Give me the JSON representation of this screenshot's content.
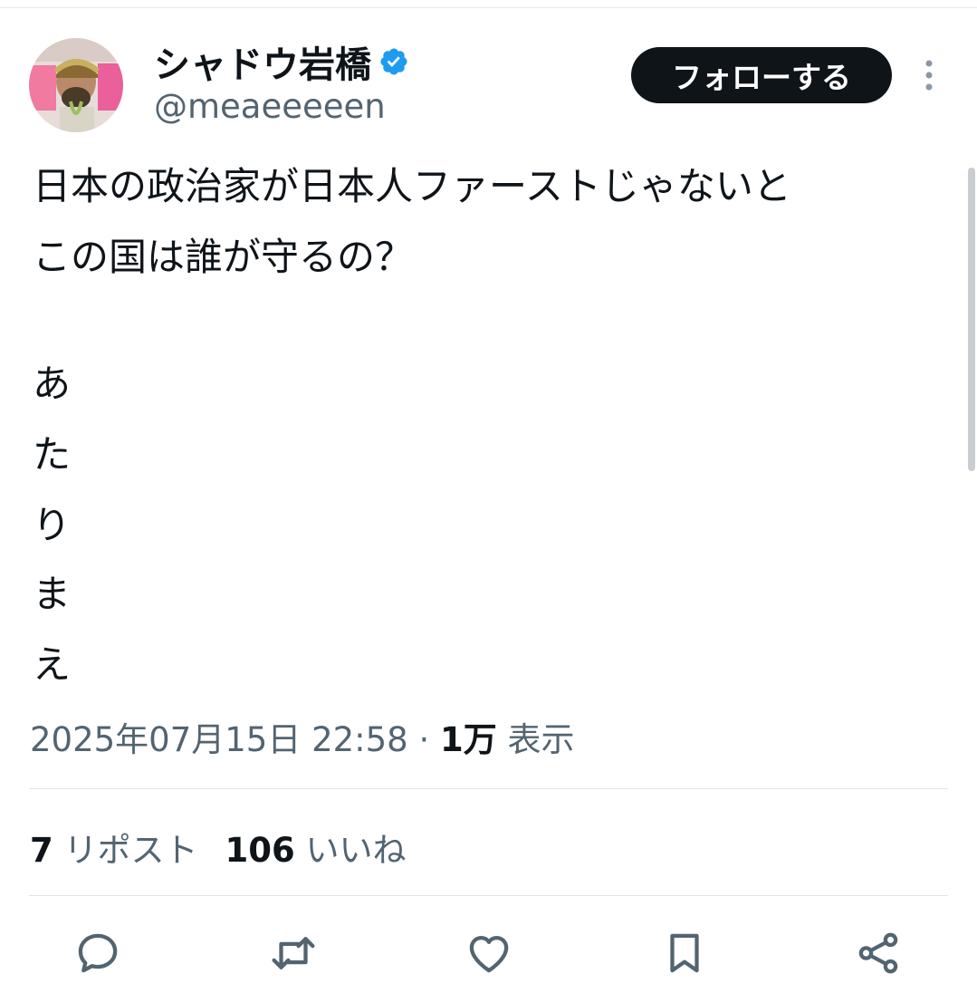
{
  "author": {
    "display_name": "シャドウ岩橋",
    "handle": "@meaeeeeen",
    "verified": true
  },
  "follow_button_label": "フォローする",
  "tweet": {
    "lines": [
      "日本の政治家が日本人ファーストじゃないと",
      "この国は誰が守るの？",
      "",
      "あ",
      "た",
      "り",
      "ま",
      "え"
    ],
    "timestamp": "2025年07月15日 22:58",
    "separator": "·",
    "views_count": "1万",
    "views_label": "表示"
  },
  "stats": {
    "reposts_count": "7",
    "reposts_label": "リポスト",
    "likes_count": "106",
    "likes_label": "いいね"
  },
  "actions": [
    "reply-icon",
    "repost-icon",
    "like-icon",
    "bookmark-icon",
    "share-icon"
  ],
  "colors": {
    "text_primary": "#0f1419",
    "text_secondary": "#536471",
    "verified_blue": "#1d9bf0",
    "follow_button_bg": "#0f1419"
  }
}
